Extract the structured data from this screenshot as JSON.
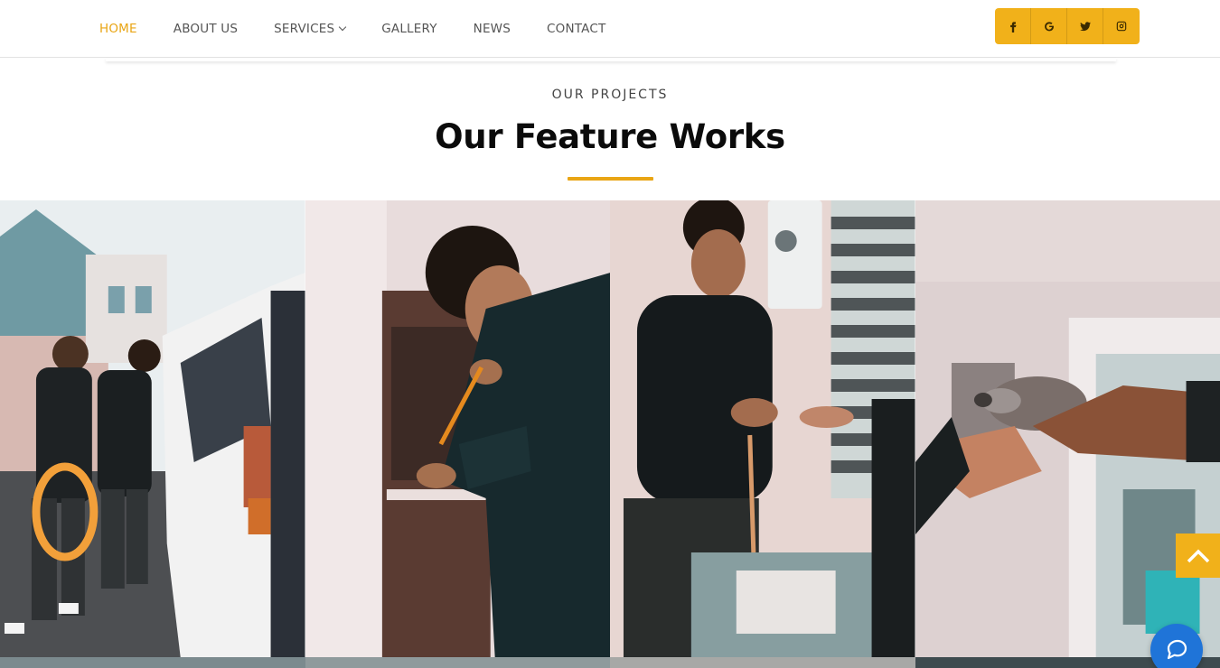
{
  "nav": {
    "items": [
      {
        "label": "HOME",
        "active": true
      },
      {
        "label": "ABOUT US"
      },
      {
        "label": "SERVICES",
        "dropdown": true
      },
      {
        "label": "GALLERY"
      },
      {
        "label": "NEWS"
      },
      {
        "label": "CONTACT"
      }
    ]
  },
  "social": {
    "icons": [
      "facebook-icon",
      "google-icon",
      "twitter-icon",
      "instagram-icon"
    ],
    "background": "#f1b11a"
  },
  "section": {
    "eyebrow": "OUR PROJECTS",
    "title": "Our Feature Works",
    "accent": "#e9a514"
  },
  "gallery": {
    "photos": [
      "technicians-van-cable-photo",
      "technician-cupboard-screwdriver-photo",
      "technician-boiler-pipe-photo",
      "hands-pipe-fitting-photo"
    ]
  },
  "floating": {
    "scroll_top_icon": "chevron-up-icon",
    "chat_icon": "chat-bubble-icon",
    "chat_color": "#1f74d8"
  }
}
